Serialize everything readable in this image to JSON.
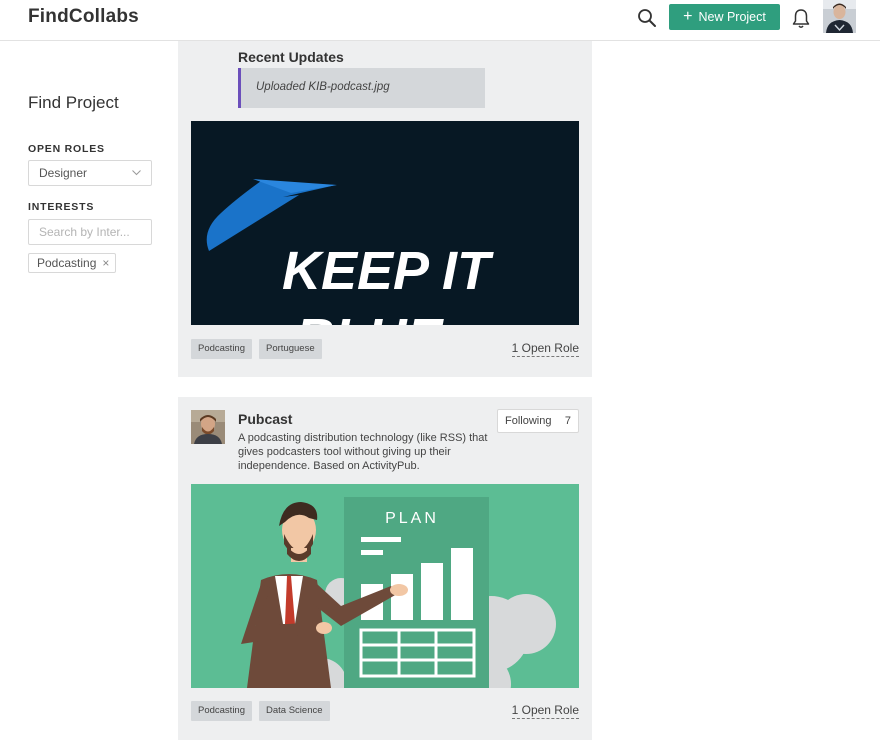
{
  "header": {
    "logo": "FindCollabs",
    "new_project_label": "New Project",
    "accent_color": "#2f9e7e"
  },
  "sidebar": {
    "title": "Find Project",
    "open_roles_label": "OPEN ROLES",
    "open_roles_selected": "Designer",
    "interests_label": "INTERESTS",
    "interests_placeholder": "Search by Inter...",
    "interest_chips": [
      {
        "label": "Podcasting"
      }
    ]
  },
  "feed": {
    "cards": [
      {
        "recent_updates_title": "Recent Updates",
        "update_text": "Uploaded KIB-podcast.jpg",
        "image_text_line1": "KEEP IT",
        "image_text_line2": "BLUE",
        "tags": [
          "Podcasting",
          "Portuguese"
        ],
        "open_roles": "1 Open Role"
      },
      {
        "name": "Pubcast",
        "description": "A podcasting distribution technology (like RSS) that gives podcasters tool without giving up their independence. Based on ActivityPub.",
        "following_label": "Following",
        "following_count": "7",
        "image_text": "PLAN",
        "tags": [
          "Podcasting",
          "Data Science"
        ],
        "open_roles": "1 Open Role"
      }
    ]
  }
}
